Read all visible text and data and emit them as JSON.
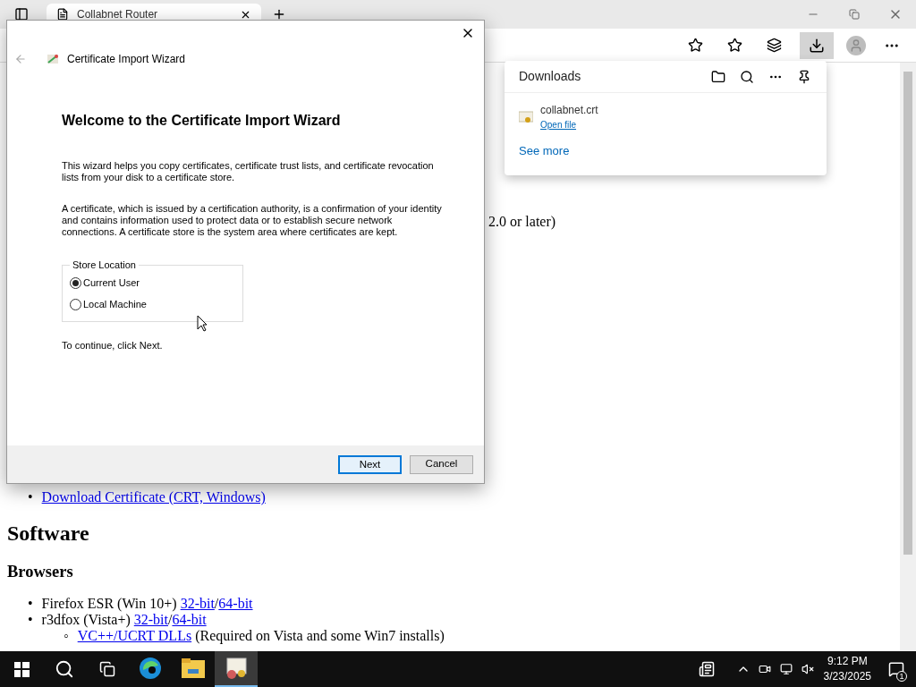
{
  "browser": {
    "tab": {
      "title": "Collabnet Router"
    }
  },
  "page": {
    "partial_line": "2.0 or later)",
    "cert_marker": "•",
    "cert_link": "Download Certificate (CRT, Windows)",
    "software_heading": "Software",
    "browsers_heading": "Browsers",
    "browsers": [
      {
        "marker": "•",
        "text": "Firefox ESR (Win 10+)",
        "links": [
          "32-bit",
          "64-bit"
        ],
        "separator": "/"
      },
      {
        "marker": "•",
        "text": "r3dfox (Vista+)",
        "links": [
          "32-bit",
          "64-bit"
        ],
        "separator": "/",
        "children": [
          {
            "marker": "◦",
            "link": "VC++/UCRT DLLs",
            "text": "(Required on Vista and some Win7 installs)"
          }
        ]
      }
    ]
  },
  "downloads": {
    "title": "Downloads",
    "items": [
      {
        "name": "collabnet.crt",
        "action": "Open file"
      }
    ],
    "see_more": "See more"
  },
  "dialog": {
    "title": "Certificate Import Wizard",
    "heading": "Welcome to the Certificate Import Wizard",
    "paragraphs": [
      "This wizard helps you copy certificates, certificate trust lists, and certificate revocation lists from your disk to a certificate store.",
      "A certificate, which is issued by a certification authority, is a confirmation of your identity and contains information used to protect data or to establish secure network connections. A certificate store is the system area where certificates are kept."
    ],
    "store_location": {
      "legend": "Store Location",
      "options": [
        {
          "label": "Current User",
          "selected": true
        },
        {
          "label": "Local Machine",
          "selected": false
        }
      ]
    },
    "hint": "To continue, click Next.",
    "buttons": [
      {
        "label": "Next",
        "kind": "primary"
      },
      {
        "label": "Cancel",
        "kind": "secondary"
      }
    ]
  },
  "taskbar": {
    "apps": [
      {
        "kind": "edge",
        "active": false
      },
      {
        "kind": "explorer",
        "active": false
      },
      {
        "kind": "certificate",
        "active": true
      }
    ],
    "time": "9:12 PM",
    "date": "3/23/2025",
    "notification_count": "1"
  }
}
